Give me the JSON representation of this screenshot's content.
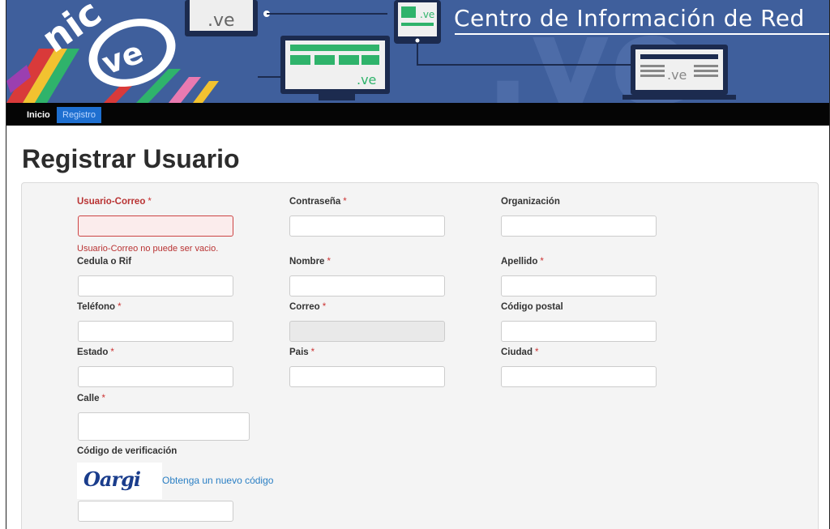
{
  "header": {
    "title": "Centro de Información de Red",
    "logo_icon": "nic-ve-logo",
    "colors": {
      "banner": "#3f5f9c",
      "accent_green": "#2fb36b",
      "accent_red": "#d93a3a"
    }
  },
  "nav": {
    "items": [
      {
        "label": "Inicio",
        "active": false
      },
      {
        "label": "Registro",
        "active": true
      }
    ]
  },
  "page_title": "Registrar Usuario",
  "form": {
    "fields": {
      "usuario_correo": {
        "label": "Usuario-Correo",
        "required": true,
        "value": "",
        "error": "Usuario-Correo no puede ser vacio."
      },
      "contrasena": {
        "label": "Contraseña",
        "required": true,
        "value": ""
      },
      "organizacion": {
        "label": "Organización",
        "required": false,
        "value": ""
      },
      "cedula": {
        "label": "Cedula o Rif",
        "required": false,
        "value": ""
      },
      "nombre": {
        "label": "Nombre",
        "required": true,
        "value": ""
      },
      "apellido": {
        "label": "Apellido",
        "required": true,
        "value": ""
      },
      "telefono": {
        "label": "Teléfono",
        "required": true,
        "value": ""
      },
      "correo": {
        "label": "Correo",
        "required": true,
        "value": "",
        "disabled": true
      },
      "codigo_postal": {
        "label": "Código postal",
        "required": false,
        "value": ""
      },
      "estado": {
        "label": "Estado",
        "required": true,
        "value": ""
      },
      "pais": {
        "label": "Pais",
        "required": true,
        "value": ""
      },
      "ciudad": {
        "label": "Ciudad",
        "required": true,
        "value": ""
      },
      "calle": {
        "label": "Calle",
        "required": true,
        "value": ""
      },
      "codigo_verificacion": {
        "label": "Código de verificación",
        "required": false,
        "value": ""
      }
    },
    "required_mark": "*",
    "captcha_text": "Oargi",
    "new_code_link": "Obtenga un nuevo código"
  }
}
